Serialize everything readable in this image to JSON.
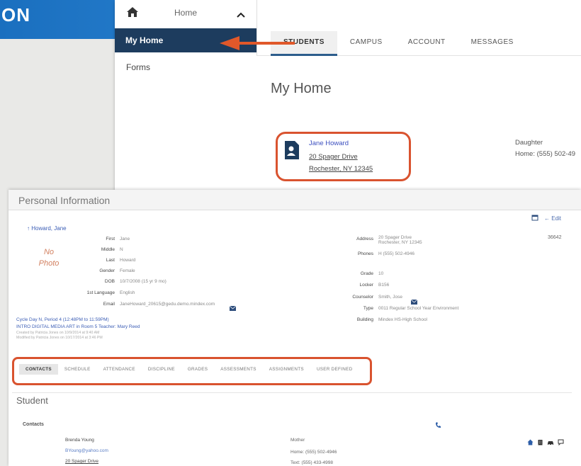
{
  "banner": {
    "title": "ON"
  },
  "sidebar": {
    "home_label": "Home",
    "my_home_label": "My Home",
    "forms_label": "Forms"
  },
  "top_tabs": [
    "STUDENTS",
    "CAMPUS",
    "ACCOUNT",
    "MESSAGES"
  ],
  "active_top_tab": "STUDENTS",
  "page_title": "My Home",
  "student_card": {
    "name": "Jane Howard",
    "address_line1": "20 Spager Drive",
    "address_line2": "Rochester, NY 12345",
    "relationship": "Daughter",
    "home_phone": "Home: (555) 502-49"
  },
  "personal_info": {
    "title": "Personal Information",
    "edit_label": "Edit",
    "id_number": "36642",
    "name_link": "Howard, Jane",
    "no_photo_line1": "No",
    "no_photo_line2": "Photo",
    "fields_left": [
      {
        "label": "First",
        "value": "Jane"
      },
      {
        "label": "Middle",
        "value": "N"
      },
      {
        "label": "Last",
        "value": "Howard"
      },
      {
        "label": "Gender",
        "value": "Female"
      },
      {
        "label": "DOB",
        "value": "10/7/2008 (15 yr 9 mo)"
      },
      {
        "label": "1st Language",
        "value": "English"
      },
      {
        "label": "Email",
        "value": "JaneHoward_20615@gedu.demo.mindex.com"
      }
    ],
    "fields_right": [
      {
        "label": "Address",
        "value": "20 Spager Drive"
      },
      {
        "label": "",
        "value": "Rochester, NY 12345"
      },
      {
        "label": "Phones",
        "value": "H (555) 502-4946"
      },
      {
        "label": "Grade",
        "value": "10"
      },
      {
        "label": "Locker",
        "value": "B156"
      },
      {
        "label": "Counselor",
        "value": "Smith, Jose"
      },
      {
        "label": "Type",
        "value": "0011 Regular School Year Environment"
      },
      {
        "label": "Building",
        "value": "Mindex HS-High School"
      }
    ],
    "schedule_line1": "Cycle Day N, Period 4 (12:48PM to 11:59PM)",
    "schedule_line2": "INTRO DIGITAL MEDIA ART in Room 5 Teacher: Mary Reed",
    "created_line": "Created by Patricia Jones on 10/9/2014 at 9:40 AM",
    "modified_line": "Modified by Patricia Jones on 10/17/2014 at 3:46 PM"
  },
  "bottom_tabs": [
    "CONTACTS",
    "SCHEDULE",
    "ATTENDANCE",
    "DISCIPLINE",
    "GRADES",
    "ASSESSMENTS",
    "ASSIGNMENTS",
    "USER DEFINED"
  ],
  "active_bottom_tab": "CONTACTS",
  "student_section": {
    "title": "Student",
    "contacts_label": "Contacts",
    "contact": {
      "name": "Brenda Young",
      "email": "BYoung@yahoo.com",
      "address": "20 Spager Drive",
      "relationship": "Mother",
      "home_phone": "Home: (555) 502-4946",
      "text_phone": "Text: (555) 433-4998"
    }
  },
  "colors": {
    "banner": "#1a6fbf",
    "sidebar_active": "#1d3c5e",
    "highlight": "#d9532f",
    "link": "#3c4fbf"
  }
}
